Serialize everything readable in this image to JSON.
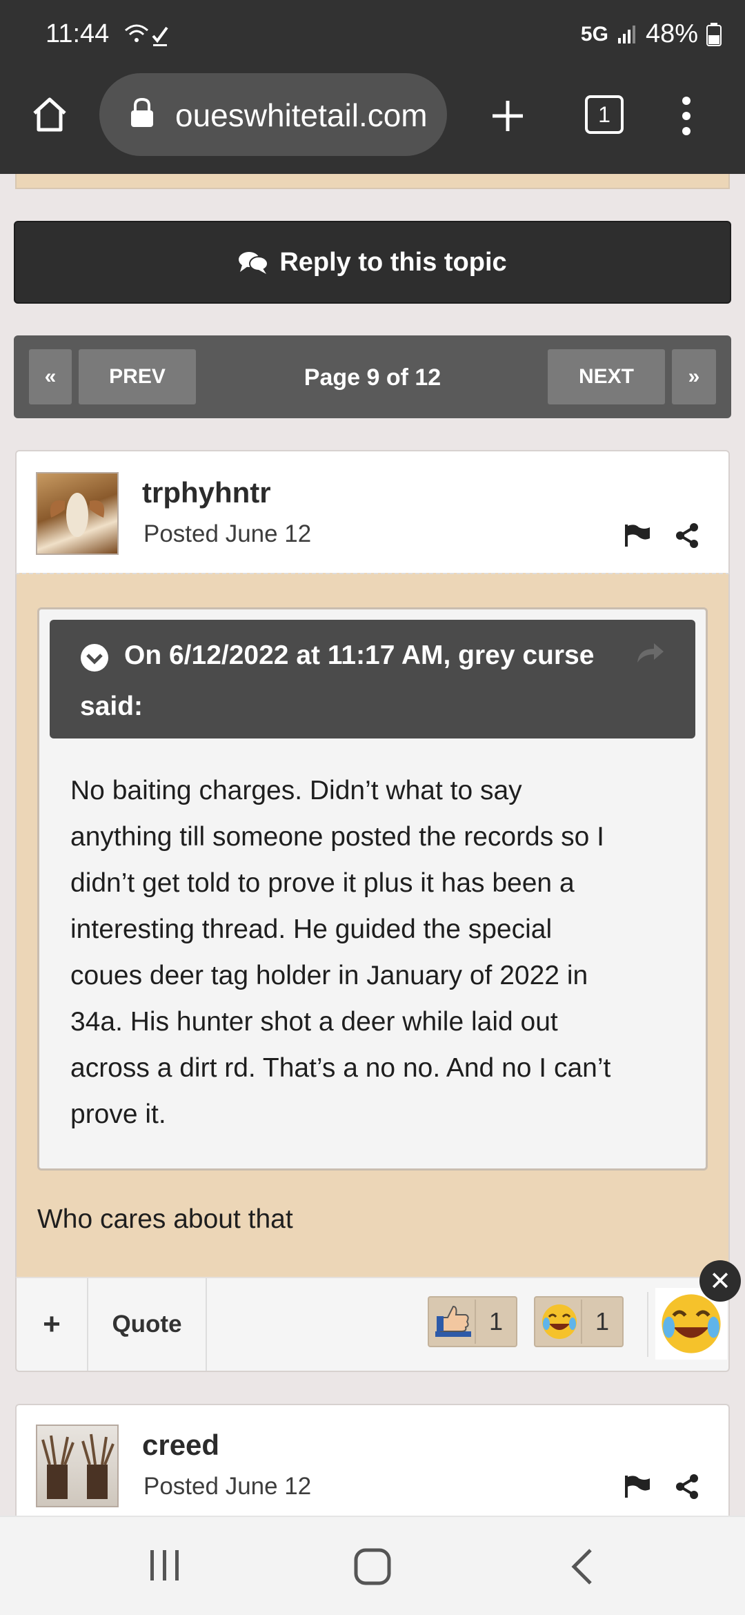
{
  "status_bar": {
    "time": "11:44",
    "network": "5G",
    "battery": "48%"
  },
  "browser": {
    "url": "oueswhitetail.com",
    "tab_count": "1"
  },
  "reply_button": "Reply to this topic",
  "pagination": {
    "prev_label": "PREV",
    "next_label": "NEXT",
    "first_label": "«",
    "last_label": "»",
    "page_text": "Page 9 of 12"
  },
  "posts": [
    {
      "username": "trphyhntr",
      "posted": "Posted June 12",
      "quote": {
        "header_line1": "On 6/12/2022 at 11:17 AM, grey curse",
        "header_line2": "said:",
        "text_lines": [
          "No baiting charges.  Didn’t what to say",
          "anything till someone posted the records so I",
          "didn’t get told to prove it plus it has been a",
          "interesting thread.   He guided the special",
          "coues deer tag holder in January of 2022 in",
          "34a.  His hunter shot a deer while laid out",
          "across a dirt rd.  That’s a no no.   And no I can’t",
          "prove it."
        ]
      },
      "reply": "Who cares about that",
      "actions": {
        "plus": "+",
        "quote": "Quote"
      },
      "reactions": [
        {
          "icon": "thumbs-up-icon",
          "count": "1"
        },
        {
          "icon": "laughing-emoji-icon",
          "count": "1"
        }
      ]
    },
    {
      "username": "creed",
      "posted": "Posted June 12"
    }
  ],
  "colors": {
    "post_body_bg": "#ecd6b7",
    "dark_bar": "#323232",
    "pager_bg": "#5a5a5a"
  }
}
